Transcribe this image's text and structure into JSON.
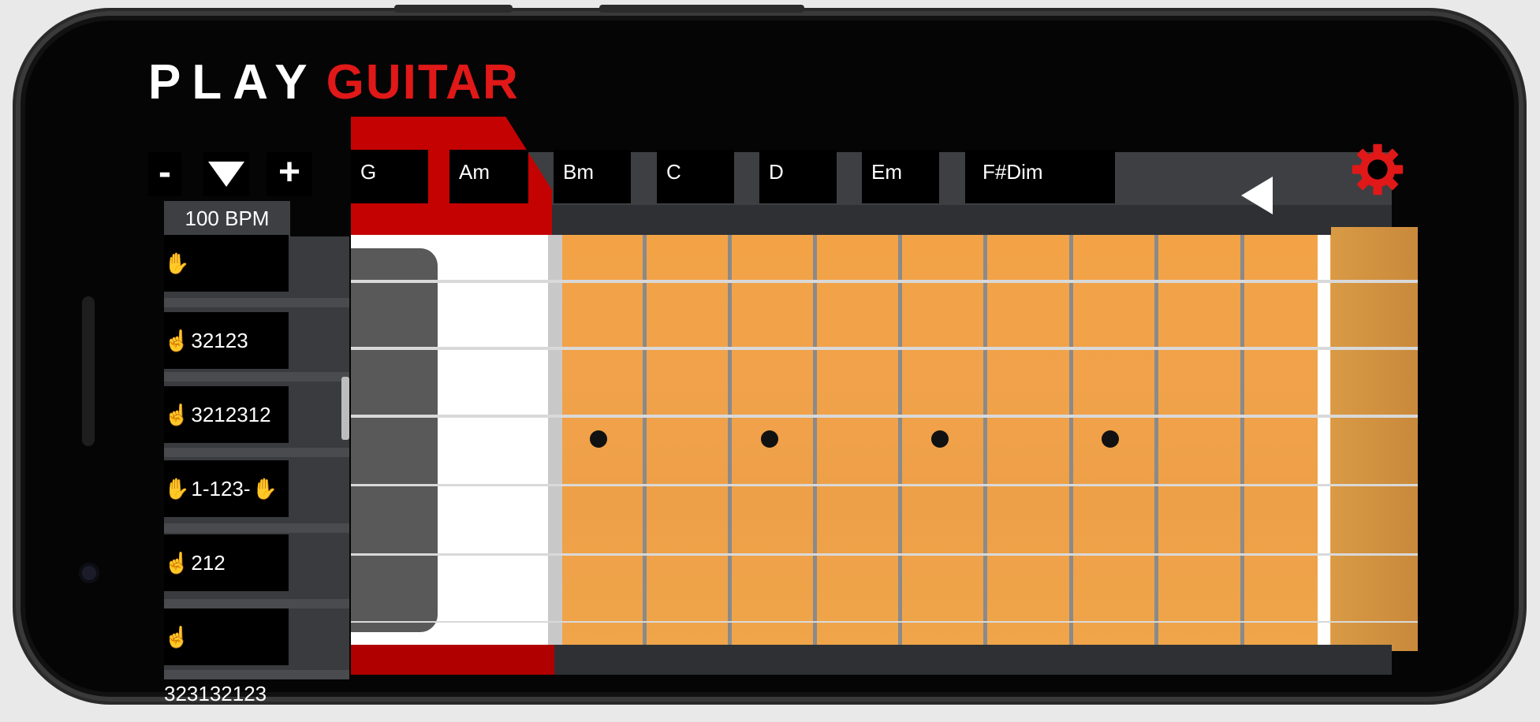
{
  "app": {
    "title_white": "PLAY",
    "title_red": "GUITAR"
  },
  "tempo": {
    "minus_label": "-",
    "plus_label": "+",
    "bpm_label": "100 BPM"
  },
  "chords": [
    "G",
    "Am",
    "Bm",
    "C",
    "D",
    "Em",
    "F#Dim"
  ],
  "rhythms": [
    {
      "pattern": ""
    },
    {
      "pattern": "32123"
    },
    {
      "pattern": "3212312"
    },
    {
      "pattern": "1-123-"
    },
    {
      "pattern": "212"
    },
    {
      "pattern": "323132123"
    }
  ],
  "icons": {
    "decrease": "minus-icon",
    "dropdown": "triangle-down-icon",
    "increase": "plus-icon",
    "back": "triangle-left-icon",
    "settings": "gear-icon",
    "strum": "hand-pointing-icon",
    "clap": "clap-icon"
  },
  "colors": {
    "brand_red": "#e01818",
    "fretboard": "#f1a24a",
    "background": "#000000",
    "strum_icon": "#f4b400"
  }
}
